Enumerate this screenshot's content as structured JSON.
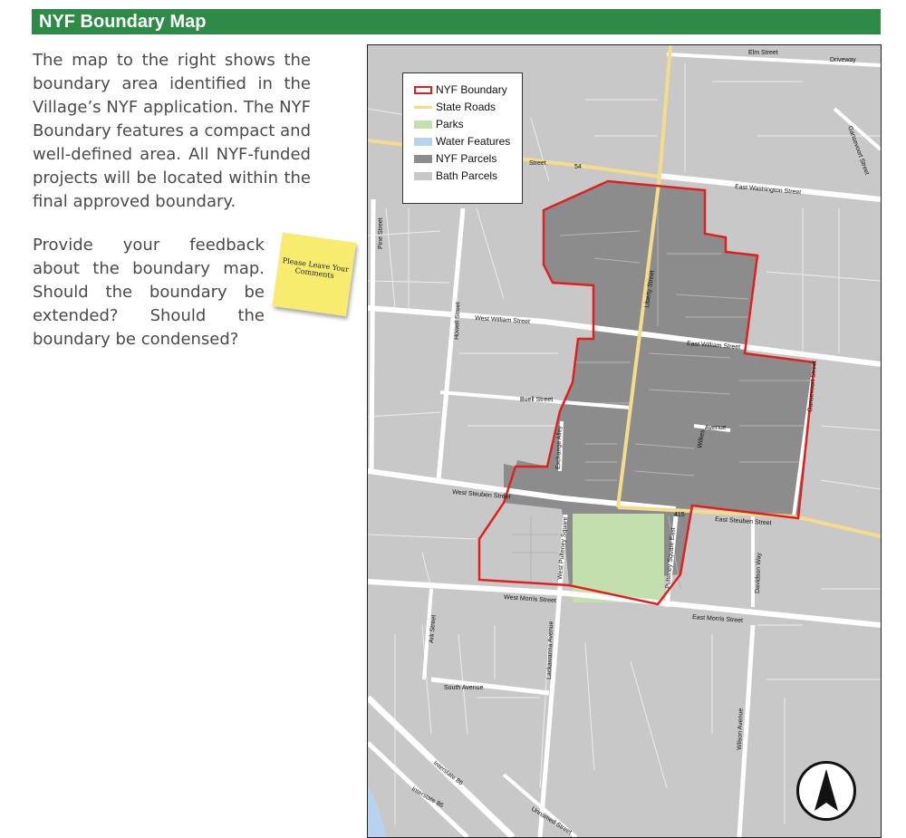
{
  "section": {
    "title": "NYF Boundary Map"
  },
  "intro_text": "The map to the right shows the boundary area identified in the Village’s NYF application. The NYF Boundary features a compact and well-defined area. All NYF-funded projects will be located within the final approved boundary.",
  "feedback_text": "Provide your feedback about the boundary map. Should the boundary be extended? Should the boundary be condensed?",
  "sticky_note": {
    "text": "Please Leave Your Comments"
  },
  "legend": {
    "items": [
      {
        "label": "NYF Boundary",
        "color": "#e02020",
        "style": "outline"
      },
      {
        "label": "State Roads",
        "color": "#f3dd8c",
        "style": "line"
      },
      {
        "label": "Parks",
        "color": "#c4dfae",
        "style": "fill"
      },
      {
        "label": "Water Features",
        "color": "#b9d3ee",
        "style": "fill"
      },
      {
        "label": "NYF Parcels",
        "color": "#8c8c8c",
        "style": "fill"
      },
      {
        "label": "Bath Parcels",
        "color": "#c8c8c8",
        "style": "fill"
      }
    ]
  },
  "streets": {
    "elm": "Elm Street",
    "driveway": "Driveway",
    "gansevoort_north": "Gansevoort Street",
    "street_partial": "Street",
    "route_54": "54",
    "east_washington": "East Washington Street",
    "pine": "Pine Street",
    "liberty": "Liberty Street",
    "howell": "Howell Street",
    "west_william": "West William Street",
    "east_william": "East William Street",
    "buell": "Buell Street",
    "exchange_alley": "Exchange Alley",
    "wilkes": "Wilkes",
    "avenue": "Avenue",
    "gansevoort": "Gansevoort Street",
    "west_steuben": "West Steuben Street",
    "route_415": "415",
    "east_steuben": "East Steuben Street",
    "west_pulteney": "West Pulteney Square",
    "pulteney_east": "Pulteney Square East",
    "davidson": "Davidson Way",
    "west_morris": "West Morris Street",
    "east_morris": "East Morris Street",
    "ark": "Ark Street",
    "lackawanna": "Lackawanna Avenue",
    "south_avenue": "South Avenue",
    "wilson": "Wilson Avenue",
    "interstate_86_a": "Interstate 86",
    "interstate_86_b": "Interstate 86",
    "unnamed": "Unnamed Street"
  },
  "colors": {
    "banner": "#2e8b47",
    "boundary": "#e02020",
    "nyf_parcels": "#8c8c8c",
    "bath_parcels": "#c8c8c8",
    "park": "#c4dfae",
    "water": "#b9d3ee",
    "state_road": "#f3dd8c",
    "road": "#ffffff"
  },
  "north_arrow": {
    "icon": "north-arrow-icon"
  }
}
